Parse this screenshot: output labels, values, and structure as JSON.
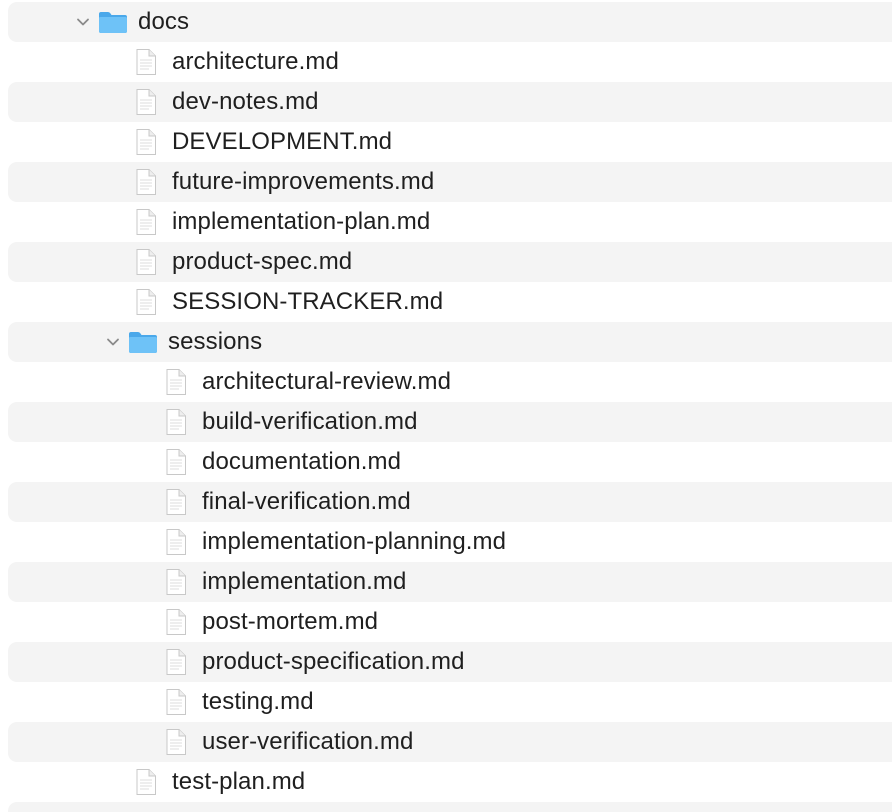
{
  "tree": {
    "root_folder": {
      "label": "docs",
      "expanded": true
    },
    "root_files": [
      {
        "label": "architecture.md"
      },
      {
        "label": "dev-notes.md"
      },
      {
        "label": "DEVELOPMENT.md"
      },
      {
        "label": "future-improvements.md"
      },
      {
        "label": "implementation-plan.md"
      },
      {
        "label": "product-spec.md"
      },
      {
        "label": "SESSION-TRACKER.md"
      }
    ],
    "sessions_folder": {
      "label": "sessions",
      "expanded": true
    },
    "session_files": [
      {
        "label": "architectural-review.md"
      },
      {
        "label": "build-verification.md"
      },
      {
        "label": "documentation.md"
      },
      {
        "label": "final-verification.md"
      },
      {
        "label": "implementation-planning.md"
      },
      {
        "label": "implementation.md"
      },
      {
        "label": "post-mortem.md"
      },
      {
        "label": "product-specification.md"
      },
      {
        "label": "testing.md"
      },
      {
        "label": "user-verification.md"
      }
    ],
    "trailing_files": [
      {
        "label": "test-plan.md"
      }
    ]
  },
  "colors": {
    "stripe": "#f4f4f4",
    "folder": "#5bb8f3",
    "text": "#1f1f1f",
    "chevron": "#8a8a8a"
  },
  "icons": {
    "folder": "folder-icon",
    "file": "document-icon",
    "disclosure": "chevron-down-icon"
  }
}
